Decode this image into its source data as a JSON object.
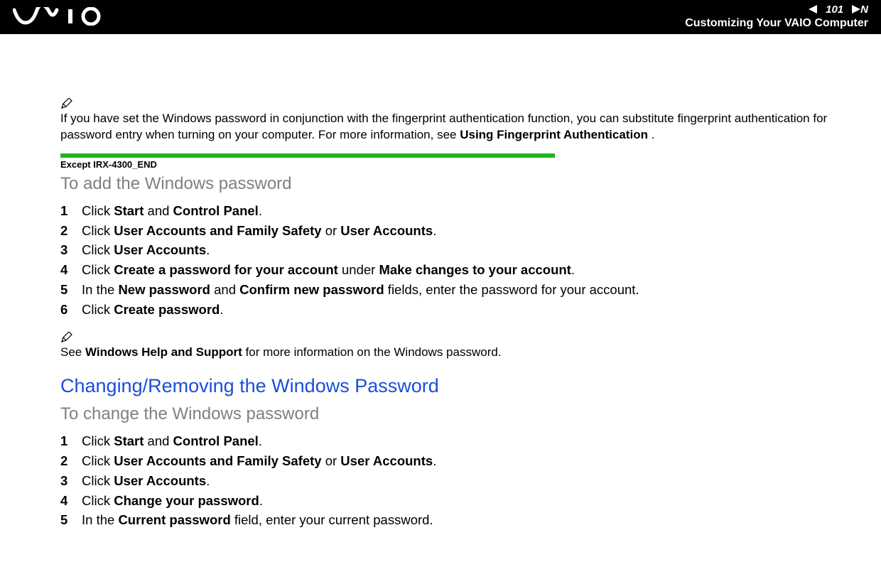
{
  "header": {
    "page_number": "101",
    "nav_letter": "N",
    "section_title": "Customizing Your VAIO Computer"
  },
  "note1": {
    "text_before": "If you have set the Windows password in conjunction with the fingerprint authentication function, you can substitute fingerprint authentication for password entry when turning on your computer. For more information, see ",
    "bold": "Using Fingerprint Authentication",
    "text_after": "  ."
  },
  "except_tag": "Except IRX-4300_END",
  "sub1": "To add the Windows password",
  "steps1": [
    {
      "n": "1",
      "pre": "Click ",
      "b1": "Start",
      "mid": " and ",
      "b2": "Control Panel",
      "post": "."
    },
    {
      "n": "2",
      "pre": "Click ",
      "b1": "User Accounts and Family Safety",
      "mid": " or ",
      "b2": "User Accounts",
      "post": "."
    },
    {
      "n": "3",
      "pre": "Click ",
      "b1": "User Accounts",
      "mid": "",
      "b2": "",
      "post": "."
    },
    {
      "n": "4",
      "pre": "Click ",
      "b1": "Create a password for your account",
      "mid": " under ",
      "b2": "Make changes to your account",
      "post": "."
    },
    {
      "n": "5",
      "pre": "In the ",
      "b1": "New password",
      "mid": " and ",
      "b2": "Confirm new password",
      "post": " fields, enter the password for your account."
    },
    {
      "n": "6",
      "pre": "Click ",
      "b1": "Create password",
      "mid": "",
      "b2": "",
      "post": "."
    }
  ],
  "note2": {
    "text_before": "See ",
    "bold": "Windows Help and Support",
    "text_after": " for more information on the Windows password."
  },
  "h2": "Changing/Removing the Windows Password",
  "sub2": "To change the Windows password",
  "steps2": [
    {
      "n": "1",
      "pre": "Click ",
      "b1": "Start",
      "mid": " and ",
      "b2": "Control Panel",
      "post": "."
    },
    {
      "n": "2",
      "pre": "Click ",
      "b1": "User Accounts and Family Safety",
      "mid": " or ",
      "b2": "User Accounts",
      "post": "."
    },
    {
      "n": "3",
      "pre": "Click ",
      "b1": "User Accounts",
      "mid": "",
      "b2": "",
      "post": "."
    },
    {
      "n": "4",
      "pre": "Click ",
      "b1": "Change your password",
      "mid": "",
      "b2": "",
      "post": "."
    },
    {
      "n": "5",
      "pre": "In the ",
      "b1": "Current password",
      "mid": "",
      "b2": "",
      "post": " field, enter your current password."
    }
  ]
}
